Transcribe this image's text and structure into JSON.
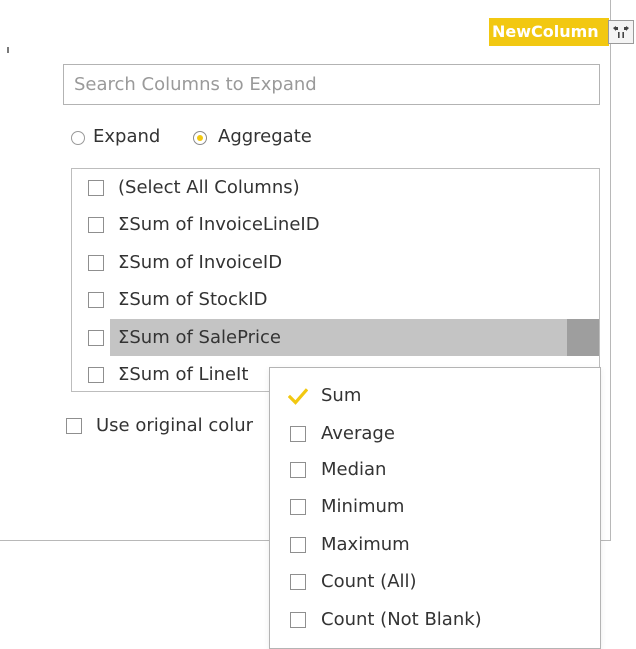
{
  "header": {
    "column_name": "NewColumn",
    "expand_icon": "expand-arrows-icon",
    "accent_color": "#F2C811"
  },
  "search": {
    "placeholder": "Search Columns to Expand",
    "value": ""
  },
  "mode": {
    "options": [
      "Expand",
      "Aggregate"
    ],
    "selected": "Aggregate"
  },
  "columns": {
    "items": [
      {
        "label": "(Select All Columns)",
        "checked": false
      },
      {
        "label": "ΣSum of InvoiceLineID",
        "checked": false
      },
      {
        "label": "ΣSum of InvoiceID",
        "checked": false
      },
      {
        "label": "ΣSum of StockID",
        "checked": false
      },
      {
        "label": "ΣSum of SalePrice",
        "checked": false,
        "highlighted": true
      },
      {
        "label": "ΣSum of LineIt",
        "checked": false
      }
    ]
  },
  "use_original": {
    "label": "Use original colur",
    "checked": false
  },
  "aggregate_menu": {
    "items": [
      {
        "label": "Sum",
        "checked": true
      },
      {
        "label": "Average",
        "checked": false
      },
      {
        "label": "Median",
        "checked": false
      },
      {
        "label": "Minimum",
        "checked": false
      },
      {
        "label": "Maximum",
        "checked": false
      },
      {
        "label": "Count (All)",
        "checked": false
      },
      {
        "label": "Count (Not Blank)",
        "checked": false
      }
    ],
    "check_color": "#F2C811"
  }
}
